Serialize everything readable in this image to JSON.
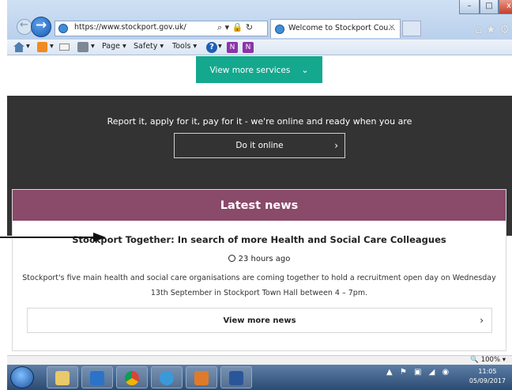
{
  "browser": {
    "url": "https://www.stockport.gov.uk/",
    "tab_label": "Welcome to Stockport Cou...",
    "tab_close": "×",
    "window_buttons": {
      "minimize": "–",
      "maximize": "□",
      "close": "x"
    },
    "command_bar": {
      "page_menu": "Page ▾",
      "safety_menu": "Safety ▾",
      "tools_menu": "Tools ▾"
    },
    "zoom": "100%"
  },
  "page": {
    "services_button": "View more services",
    "online_tagline": "Report it, apply for it, pay for it - we're online and ready when you are",
    "online_button": "Do it online",
    "news": {
      "heading": "Latest news",
      "title": "Stockport Together: In search of more Health and Social Care Colleagues",
      "time": "23 hours ago",
      "body": "Stockport's five main health and social care organisations are coming together to hold a recruitment open day on Wednesday 13th September in Stockport Town Hall between 4 – 7pm.",
      "more_button": "View more news"
    }
  },
  "taskbar": {
    "time": "11:05",
    "date": "05/09/2017"
  },
  "icons": {
    "chevron": "›",
    "chevron_down": "⌄"
  }
}
